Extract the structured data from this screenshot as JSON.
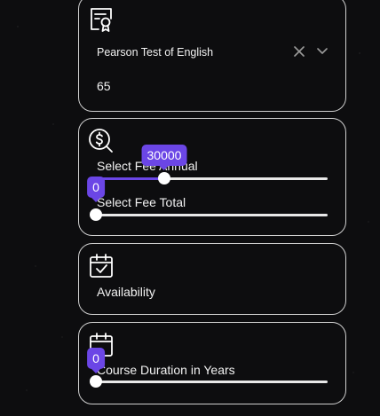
{
  "test_card": {
    "icon": "certificate-icon",
    "test_name": "Pearson Test of English",
    "score": "65",
    "clear_icon": "close-icon",
    "toggle_icon": "chevron-down-icon"
  },
  "fee_card": {
    "icon": "dollar-search-icon",
    "annual": {
      "label": "Select Fee Annual",
      "value": "30000",
      "fraction": 0.295
    },
    "total": {
      "label": "Select Fee Total",
      "value": "0",
      "fraction": 0
    }
  },
  "availability_card": {
    "icon": "calendar-check-icon",
    "label": "Availability"
  },
  "duration_card": {
    "icon": "calendar-icon",
    "label": "Course Duration in Years",
    "value": "0",
    "fraction": 0
  },
  "colors": {
    "accent": "#6b46e6",
    "border": "#cfcfcf",
    "background": "#0d0d0f"
  }
}
